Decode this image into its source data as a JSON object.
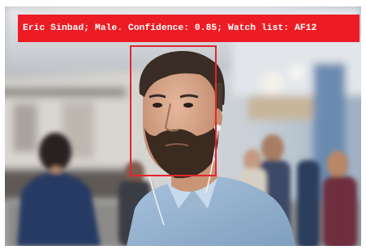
{
  "detection": {
    "label_text": "Eric Sinbad; Male. Confidence: 0.85; Watch list: AF12",
    "banner_color": "#ed1c24",
    "box_color": "#e3262d",
    "text_color": "#ffffff"
  },
  "photo": {
    "subject": "bearded-man-with-earphones-on-train-platform"
  }
}
